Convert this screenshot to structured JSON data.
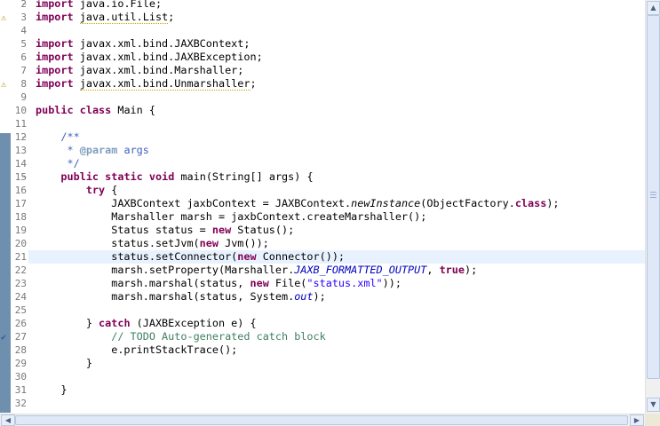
{
  "editor": {
    "current_line": 21,
    "lines": [
      {
        "n": "2",
        "fold": "−",
        "segs": [
          {
            "c": "kw",
            "t": "import"
          },
          {
            "t": " java.io.File;"
          }
        ]
      },
      {
        "n": "3",
        "segs": [
          {
            "c": "kw",
            "t": "import"
          },
          {
            "t": " "
          },
          {
            "c": "warnu",
            "t": "java.util.List"
          },
          {
            "t": ";"
          }
        ]
      },
      {
        "n": "4",
        "segs": []
      },
      {
        "n": "5",
        "segs": [
          {
            "c": "kw",
            "t": "import"
          },
          {
            "t": " javax.xml.bind.JAXBContext;"
          }
        ]
      },
      {
        "n": "6",
        "segs": [
          {
            "c": "kw",
            "t": "import"
          },
          {
            "t": " javax.xml.bind.JAXBException;"
          }
        ]
      },
      {
        "n": "7",
        "segs": [
          {
            "c": "kw",
            "t": "import"
          },
          {
            "t": " javax.xml.bind.Marshaller;"
          }
        ]
      },
      {
        "n": "8",
        "segs": [
          {
            "c": "kw",
            "t": "import"
          },
          {
            "t": " "
          },
          {
            "c": "warnu",
            "t": "javax.xml.bind.Unmarshaller"
          },
          {
            "t": ";"
          }
        ]
      },
      {
        "n": "9",
        "segs": []
      },
      {
        "n": "10",
        "segs": [
          {
            "c": "kw",
            "t": "public"
          },
          {
            "t": " "
          },
          {
            "c": "kw",
            "t": "class"
          },
          {
            "t": " Main {"
          }
        ]
      },
      {
        "n": "11",
        "segs": []
      },
      {
        "n": "12",
        "fold": "−",
        "segs": [
          {
            "t": "    "
          },
          {
            "c": "jd",
            "t": "/**"
          }
        ]
      },
      {
        "n": "13",
        "segs": [
          {
            "t": "    "
          },
          {
            "c": "jd",
            "t": " * "
          },
          {
            "c": "tag",
            "t": "@param"
          },
          {
            "c": "jd",
            "t": " args"
          }
        ]
      },
      {
        "n": "14",
        "segs": [
          {
            "t": "    "
          },
          {
            "c": "jd",
            "t": " */"
          }
        ]
      },
      {
        "n": "15",
        "fold": "−",
        "segs": [
          {
            "t": "    "
          },
          {
            "c": "kw",
            "t": "public"
          },
          {
            "t": " "
          },
          {
            "c": "kw",
            "t": "static"
          },
          {
            "t": " "
          },
          {
            "c": "kw",
            "t": "void"
          },
          {
            "t": " main(String[] args) {"
          }
        ]
      },
      {
        "n": "16",
        "segs": [
          {
            "t": "        "
          },
          {
            "c": "kw",
            "t": "try"
          },
          {
            "t": " {"
          }
        ]
      },
      {
        "n": "17",
        "segs": [
          {
            "t": "            JAXBContext jaxbContext = JAXBContext."
          },
          {
            "c": "it",
            "t": "newInstance"
          },
          {
            "t": "(ObjectFactory."
          },
          {
            "c": "kw",
            "t": "class"
          },
          {
            "t": ");"
          }
        ]
      },
      {
        "n": "18",
        "segs": [
          {
            "t": "            Marshaller marsh = jaxbContext.createMarshaller();"
          }
        ]
      },
      {
        "n": "19",
        "segs": [
          {
            "t": "            Status status = "
          },
          {
            "c": "kw",
            "t": "new"
          },
          {
            "t": " Status();"
          }
        ]
      },
      {
        "n": "20",
        "segs": [
          {
            "t": "            status.setJvm("
          },
          {
            "c": "kw",
            "t": "new"
          },
          {
            "t": " Jvm());"
          }
        ]
      },
      {
        "n": "21",
        "segs": [
          {
            "t": "            status.setConnector("
          },
          {
            "c": "kw",
            "t": "new"
          },
          {
            "t": " Connector());"
          }
        ]
      },
      {
        "n": "22",
        "segs": [
          {
            "t": "            marsh.setProperty(Marshaller."
          },
          {
            "c": "fld",
            "t": "JAXB_FORMATTED_OUTPUT"
          },
          {
            "t": ", "
          },
          {
            "c": "kw",
            "t": "true"
          },
          {
            "t": ");"
          }
        ]
      },
      {
        "n": "23",
        "segs": [
          {
            "t": "            marsh.marshal(status, "
          },
          {
            "c": "kw",
            "t": "new"
          },
          {
            "t": " File("
          },
          {
            "c": "str",
            "t": "\"status.xml\""
          },
          {
            "t": "));"
          }
        ]
      },
      {
        "n": "24",
        "segs": [
          {
            "t": "            marsh.marshal(status, System."
          },
          {
            "c": "fld",
            "t": "out"
          },
          {
            "t": ");"
          }
        ]
      },
      {
        "n": "25",
        "segs": []
      },
      {
        "n": "26",
        "segs": [
          {
            "t": "        } "
          },
          {
            "c": "kw",
            "t": "catch"
          },
          {
            "t": " (JAXBException e) {"
          }
        ]
      },
      {
        "n": "27",
        "segs": [
          {
            "t": "            "
          },
          {
            "c": "cmt",
            "t": "// TODO Auto-generated catch block"
          }
        ]
      },
      {
        "n": "28",
        "segs": [
          {
            "t": "            e.printStackTrace();"
          }
        ]
      },
      {
        "n": "29",
        "segs": [
          {
            "t": "        }"
          }
        ]
      },
      {
        "n": "30",
        "segs": []
      },
      {
        "n": "31",
        "segs": [
          {
            "t": "    }"
          }
        ]
      },
      {
        "n": "32",
        "segs": []
      }
    ],
    "markers": [
      {
        "line": "3",
        "icon": "warning-icon",
        "glyph": "⚠"
      },
      {
        "line": "8",
        "icon": "warning-icon",
        "glyph": "⚠"
      },
      {
        "line": "27",
        "icon": "task-icon",
        "glyph": "✔"
      }
    ]
  },
  "scrollbars": {
    "up_icon": "▲",
    "down_icon": "▼",
    "left_icon": "◀",
    "right_icon": "▶"
  }
}
